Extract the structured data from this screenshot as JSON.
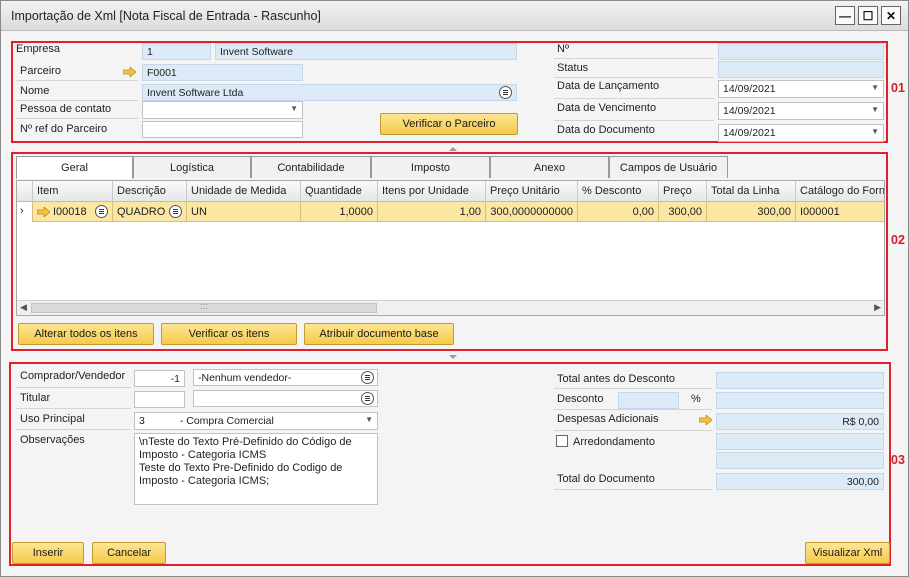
{
  "window": {
    "title": "Importação de Xml [Nota Fiscal de Entrada - Rascunho]",
    "minimize": "—",
    "maximize": "☐",
    "close": "✕"
  },
  "sections": {
    "s1": "01",
    "s2": "02",
    "s3": "03"
  },
  "header": {
    "empresa_label": "Empresa",
    "empresa_code": "1",
    "empresa_name": "Invent Software",
    "parceiro_label": "Parceiro",
    "parceiro_value": "F0001",
    "nome_label": "Nome",
    "nome_value": "Invent Software Ltda",
    "contato_label": "Pessoa de contato",
    "contato_value": "",
    "nref_label": "Nº ref do Parceiro",
    "nref_value": "",
    "verificar_parceiro": "Verificar o Parceiro",
    "numero_label": "Nº",
    "numero_value": "",
    "status_label": "Status",
    "status_value": "",
    "lancamento_label": "Data de Lançamento",
    "lancamento_value": "14/09/2021",
    "vencimento_label": "Data de Vencimento",
    "vencimento_value": "14/09/2021",
    "documento_label": "Data do Documento",
    "documento_value": "14/09/2021"
  },
  "tabs": [
    "Geral",
    "Logística",
    "Contabilidade",
    "Imposto",
    "Anexo",
    "Campos de Usuário"
  ],
  "grid": {
    "columns": [
      "Item",
      "Descrição",
      "Unidade de Medida",
      "Quantidade",
      "Itens por Unidade",
      "Preço Unitário",
      "% Desconto",
      "Preço",
      "Total da Linha",
      "Catálogo do Forne"
    ],
    "row": {
      "item": "I00018",
      "descricao": "QUADRO",
      "unidade": "UN",
      "quantidade": "1,0000",
      "itens_unidade": "1,00",
      "preco_unitario": "300,0000000000",
      "desconto": "0,00",
      "preco": "300,00",
      "total_linha": "300,00",
      "catalogo": "I000001"
    },
    "scroll_grip": ":::"
  },
  "grid_buttons": {
    "alterar": "Alterar todos os itens",
    "verificar": "Verificar os itens",
    "atribuir": "Atribuir documento base"
  },
  "footer": {
    "comprador_label": "Comprador/Vendedor",
    "comprador_code": "-1",
    "comprador_value": "-Nenhum vendedor-",
    "titular_label": "Titular",
    "titular_code": "",
    "titular_value": "",
    "uso_label": "Uso Principal",
    "uso_value": "3            - Compra Comercial",
    "obs_label": "Observações",
    "obs_value": "\\nTeste do Texto Pré-Definido do Código de Imposto - Categoria ICMS\nTeste do Texto Pre-Definido do Codigo de Imposto - Categoria ICMS;",
    "total_antes_label": "Total antes do Desconto",
    "total_antes_value": "",
    "desconto_label": "Desconto",
    "desconto_pct": "",
    "pct_symbol": "%",
    "desconto_value": "",
    "despesas_label": "Despesas Adicionais",
    "despesas_value": "R$ 0,00",
    "arredondamento_label": "Arredondamento",
    "arredondamento_value": "",
    "extra_value": "",
    "total_doc_label": "Total do Documento",
    "total_doc_value": "300,00"
  },
  "actions": {
    "inserir": "Inserir",
    "cancelar": "Cancelar",
    "visualizar": "Visualizar Xml"
  }
}
